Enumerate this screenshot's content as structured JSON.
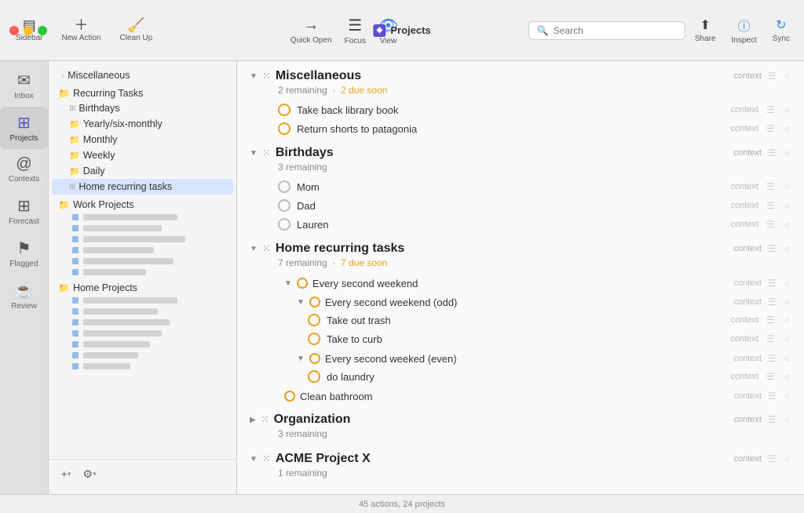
{
  "window": {
    "title": "Projects"
  },
  "toolbar": {
    "sidebar_label": "Sidebar",
    "new_action_label": "New Action",
    "clean_up_label": "Clean Up",
    "quick_open_label": "Quick Open",
    "focus_label": "Focus",
    "view_label": "View",
    "search_placeholder": "Search",
    "search_label": "Search",
    "share_label": "Share",
    "inspect_label": "Inspect",
    "sync_label": "Sync"
  },
  "sidebar": {
    "icons": [
      {
        "id": "inbox",
        "label": "Inbox",
        "icon": "✉"
      },
      {
        "id": "projects",
        "label": "Projects",
        "icon": "⊞",
        "active": true
      },
      {
        "id": "contexts",
        "label": "Contexts",
        "icon": "◎"
      },
      {
        "id": "forecast",
        "label": "Forecast",
        "icon": "⊞"
      },
      {
        "id": "flagged",
        "label": "Flagged",
        "icon": "⚑"
      },
      {
        "id": "review",
        "label": "Review",
        "icon": "☕"
      }
    ],
    "items": [
      {
        "id": "miscellaneous",
        "label": "Miscellaneous",
        "icon": "◦",
        "type": "item",
        "indent": 0
      },
      {
        "id": "recurring-tasks",
        "label": "Recurring Tasks",
        "icon": "📁",
        "type": "group",
        "indent": 0
      },
      {
        "id": "birthdays",
        "label": "Birthdays",
        "icon": "⊞",
        "type": "item",
        "indent": 1
      },
      {
        "id": "yearly",
        "label": "Yearly/six-monthly",
        "icon": "📁",
        "type": "item",
        "indent": 1
      },
      {
        "id": "monthly",
        "label": "Monthly",
        "icon": "📁",
        "type": "item",
        "indent": 1
      },
      {
        "id": "weekly",
        "label": "Weekly",
        "icon": "📁",
        "type": "item",
        "indent": 1
      },
      {
        "id": "daily",
        "label": "Daily",
        "icon": "📁",
        "type": "item",
        "indent": 1
      },
      {
        "id": "home-recurring",
        "label": "Home recurring tasks",
        "icon": "⊞",
        "type": "item",
        "indent": 1,
        "active": true
      },
      {
        "id": "work-projects",
        "label": "Work Projects",
        "icon": "📁",
        "type": "group",
        "indent": 0
      },
      {
        "id": "home-projects",
        "label": "Home Projects",
        "icon": "📁",
        "type": "group",
        "indent": 0
      }
    ],
    "add_label": "+",
    "settings_label": "⚙"
  },
  "content": {
    "sections": [
      {
        "id": "miscellaneous",
        "title": "Miscellaneous",
        "remaining": "2 remaining",
        "due_soon": "2 due soon",
        "expanded": true,
        "tasks": [
          {
            "id": "t1",
            "label": "Take back library book",
            "checkbox": "yellow"
          },
          {
            "id": "t2",
            "label": "Return shorts to patagonia",
            "checkbox": "yellow"
          }
        ]
      },
      {
        "id": "birthdays",
        "title": "Birthdays",
        "remaining": "3 remaining",
        "due_soon": null,
        "expanded": true,
        "tasks": [
          {
            "id": "t3",
            "label": "Mom",
            "checkbox": "grey"
          },
          {
            "id": "t4",
            "label": "Dad",
            "checkbox": "grey"
          },
          {
            "id": "t5",
            "label": "Lauren",
            "checkbox": "grey"
          }
        ]
      },
      {
        "id": "home-recurring",
        "title": "Home recurring tasks",
        "remaining": "7 remaining",
        "due_soon": "7 due soon",
        "expanded": true
      },
      {
        "id": "organization",
        "title": "Organization",
        "remaining": "3 remaining",
        "due_soon": null,
        "expanded": false
      },
      {
        "id": "acme",
        "title": "ACME Project X",
        "remaining": "1 remaining",
        "due_soon": null,
        "expanded": true
      }
    ],
    "home_recurring": {
      "sub_sections": [
        {
          "id": "every-second-weekend",
          "label": "Every second weekend",
          "checkbox": "yellow",
          "expanded": true,
          "children": [
            {
              "id": "every-second-weekend-odd",
              "label": "Every second weekend (odd)",
              "checkbox": "yellow",
              "expanded": true,
              "tasks": [
                {
                  "id": "t6",
                  "label": "Take out trash",
                  "checkbox": "yellow"
                },
                {
                  "id": "t7",
                  "label": "Take to curb",
                  "checkbox": "yellow"
                }
              ]
            },
            {
              "id": "every-second-weekend-even",
              "label": "Every second weeked (even)",
              "checkbox": "yellow",
              "expanded": true,
              "tasks": [
                {
                  "id": "t8",
                  "label": "do laundry",
                  "checkbox": "yellow"
                }
              ]
            }
          ]
        },
        {
          "id": "clean-bathroom",
          "label": "Clean bathroom",
          "checkbox": "yellow",
          "expanded": false
        }
      ]
    },
    "status_bar": "45 actions, 24 projects"
  }
}
